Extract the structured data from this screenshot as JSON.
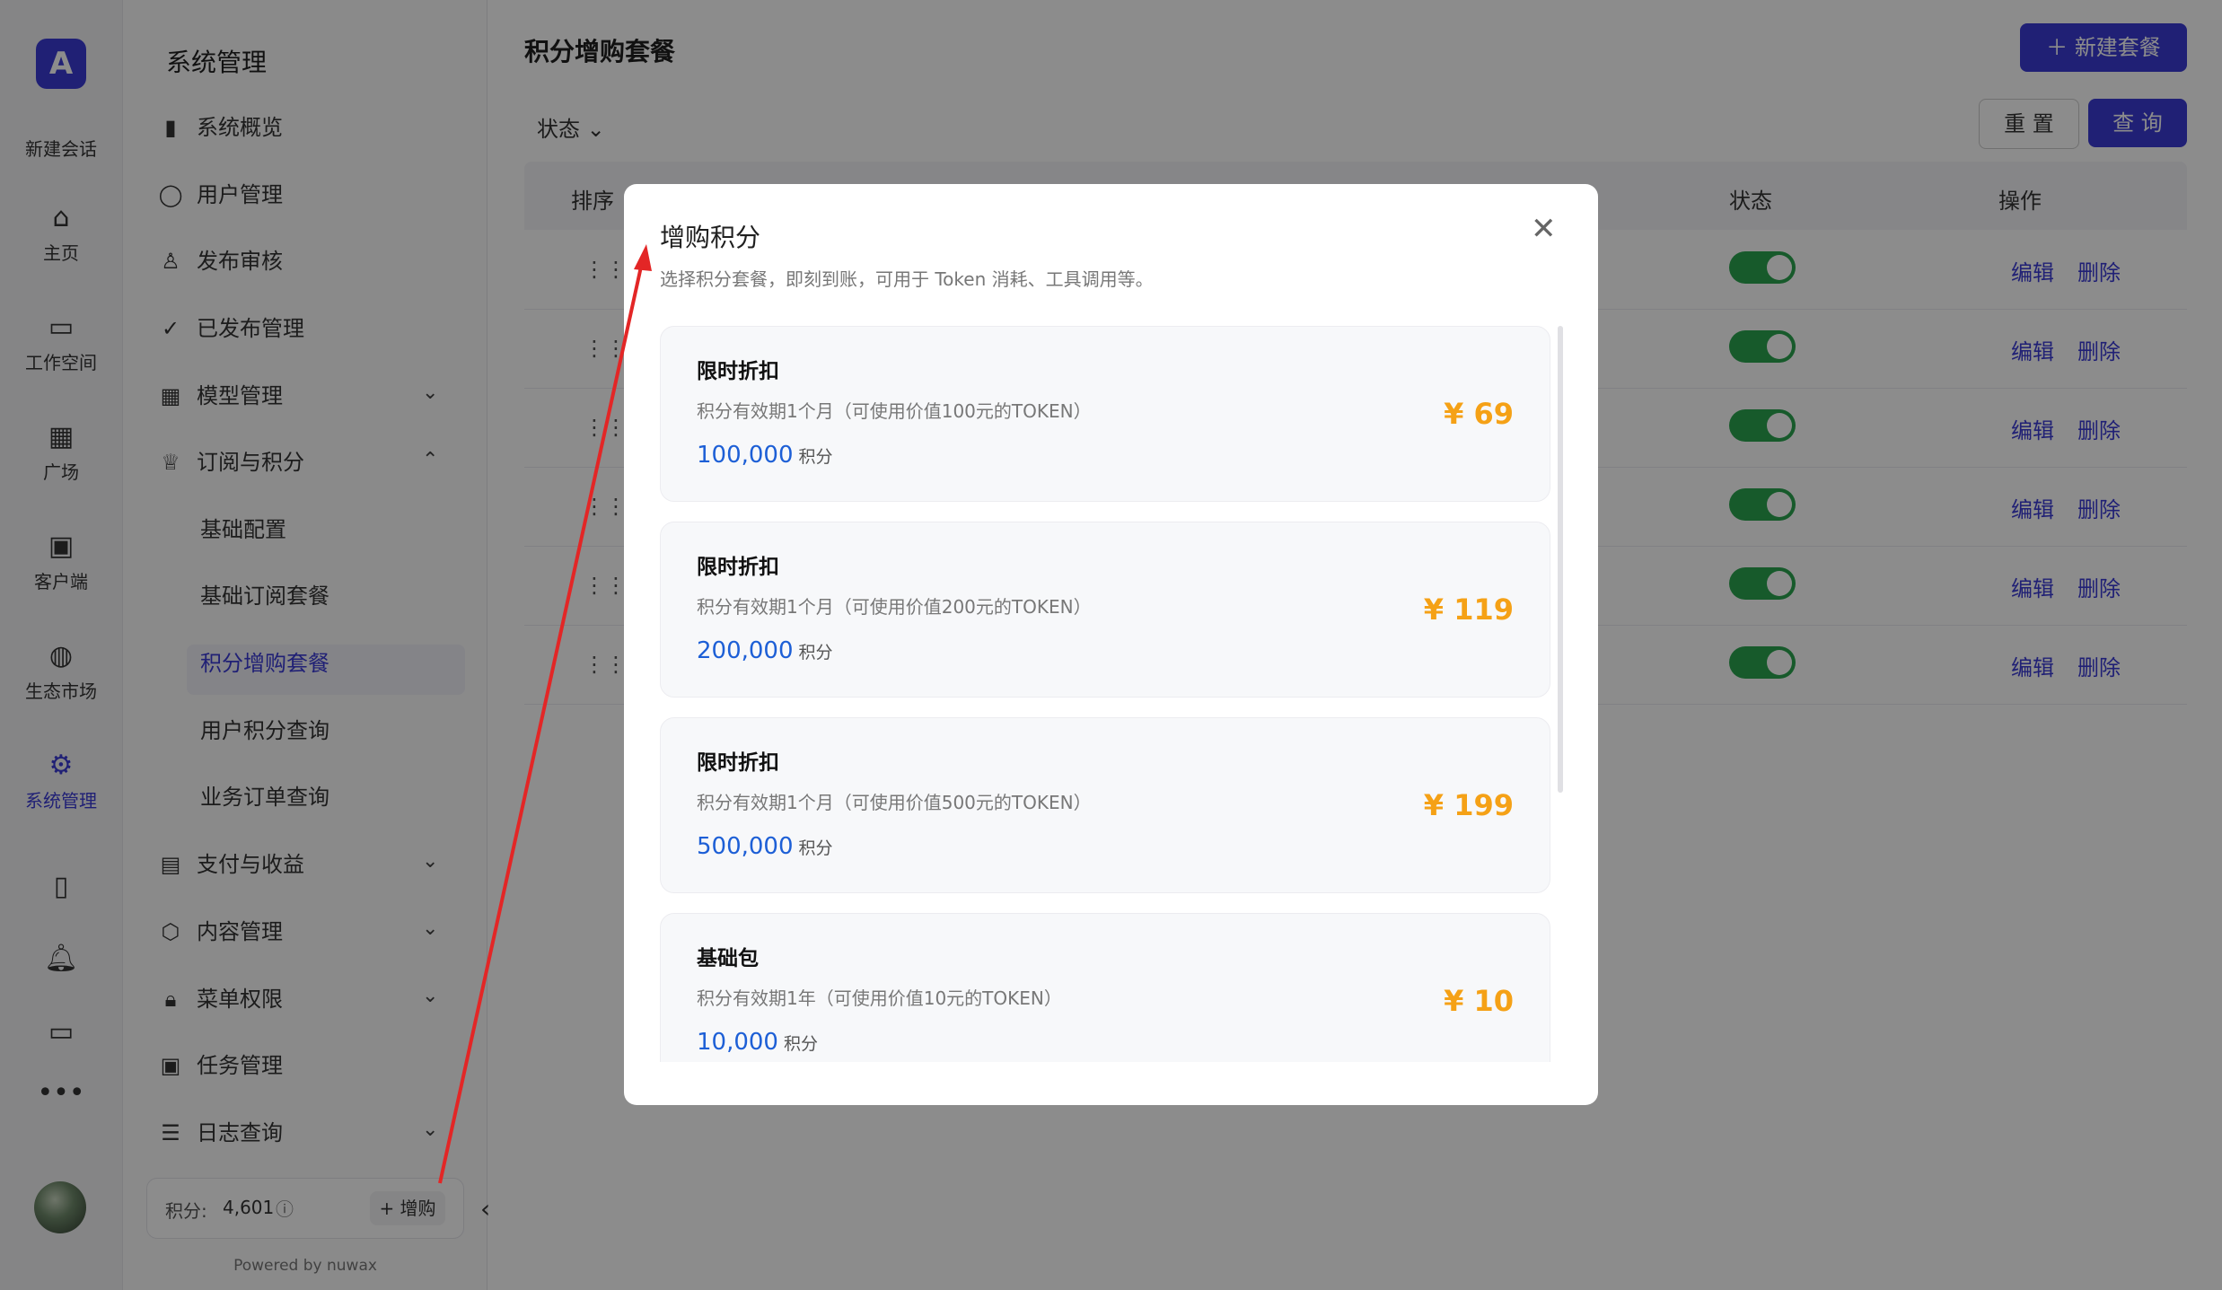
{
  "rail": {
    "new_chat": "新建会话",
    "items": [
      {
        "label": "主页",
        "icon": "home-icon"
      },
      {
        "label": "工作空间",
        "icon": "folder-icon"
      },
      {
        "label": "广场",
        "icon": "grid-icon"
      },
      {
        "label": "客户端",
        "icon": "client-icon"
      },
      {
        "label": "生态市场",
        "icon": "globe-icon"
      },
      {
        "label": "系统管理",
        "icon": "gear-icon"
      }
    ],
    "more": "•••"
  },
  "menu": {
    "title": "系统管理",
    "items": [
      {
        "label": "系统概览"
      },
      {
        "label": "用户管理"
      },
      {
        "label": "发布审核"
      },
      {
        "label": "已发布管理"
      },
      {
        "label": "模型管理"
      },
      {
        "label": "订阅与积分"
      },
      {
        "label": "支付与收益"
      },
      {
        "label": "内容管理"
      },
      {
        "label": "菜单权限"
      },
      {
        "label": "任务管理"
      },
      {
        "label": "日志查询"
      }
    ],
    "sub_items": [
      {
        "label": "基础配置"
      },
      {
        "label": "基础订阅套餐"
      },
      {
        "label": "积分增购套餐"
      },
      {
        "label": "用户积分查询"
      },
      {
        "label": "业务订单查询"
      }
    ],
    "points_label": "积分:",
    "points_value": "4,601",
    "buy_label": "+ 增购",
    "powered": "Powered by nuwax"
  },
  "main": {
    "title": "积分增购套餐",
    "new_button": "新建套餐",
    "filter_label": "状态",
    "reset": "重 置",
    "query": "查 询",
    "columns": [
      "排序",
      "状态",
      "操作"
    ],
    "edit": "编辑",
    "delete": "删除"
  },
  "modal": {
    "title": "增购积分",
    "description": "选择积分套餐，即刻到账，可用于 Token 消耗、工具调用等。",
    "cards": [
      {
        "name": "限时折扣",
        "desc": "积分有效期1个月（可使用价值100元的TOKEN）",
        "amount": "100,000",
        "unit": "积分",
        "price": "¥ 69"
      },
      {
        "name": "限时折扣",
        "desc": "积分有效期1个月（可使用价值200元的TOKEN）",
        "amount": "200,000",
        "unit": "积分",
        "price": "¥ 119"
      },
      {
        "name": "限时折扣",
        "desc": "积分有效期1个月（可使用价值500元的TOKEN）",
        "amount": "500,000",
        "unit": "积分",
        "price": "¥ 199"
      },
      {
        "name": "基础包",
        "desc": "积分有效期1年（可使用价值10元的TOKEN）",
        "amount": "10,000",
        "unit": "积分",
        "price": "¥ 10"
      }
    ]
  },
  "colors": {
    "accent": "#3b3bd6",
    "price": "#f5a116",
    "amount": "#1d5fd6",
    "toggle_on": "#2aa44f",
    "annotation_arrow": "#e32626"
  }
}
